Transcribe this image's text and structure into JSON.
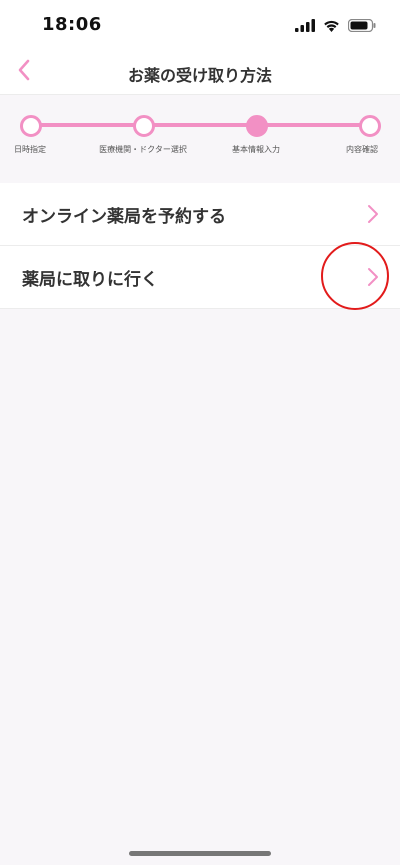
{
  "status_bar": {
    "time": "18:06"
  },
  "header": {
    "title": "お薬の受け取り方法",
    "back_icon": "chevron-left-icon"
  },
  "stepper": {
    "steps": [
      {
        "label": "日時指定",
        "state": "completed"
      },
      {
        "label": "医療機関・ドクター選択",
        "state": "completed"
      },
      {
        "label": "基本情報入力",
        "state": "current"
      },
      {
        "label": "内容確認",
        "state": "pending"
      }
    ]
  },
  "options": [
    {
      "label": "オンライン薬局を予約する",
      "icon": "chevron-right-icon"
    },
    {
      "label": "薬局に取りに行く",
      "icon": "chevron-right-icon"
    }
  ],
  "colors": {
    "accent": "#f290c4",
    "annotation": "#e21b1b",
    "background": "#f8f6f9"
  }
}
